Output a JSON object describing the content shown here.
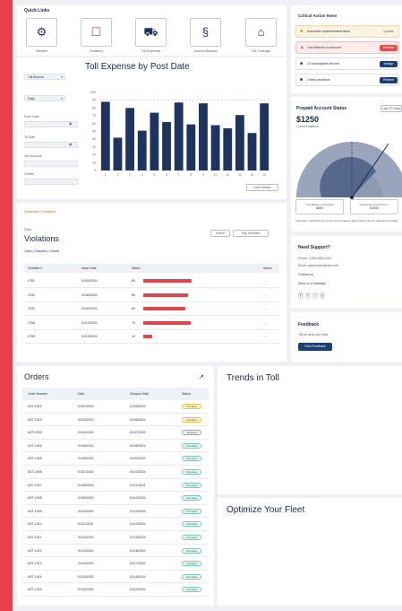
{
  "quick_links": {
    "title": "Quick Links",
    "items": [
      {
        "label": "Vehicles",
        "icon": "vehicle-icon"
      },
      {
        "label": "Violations",
        "icon": "violation-icon"
      },
      {
        "label": "Toll Expenses",
        "icon": "toll-icon"
      },
      {
        "label": "Account Balance",
        "icon": "balance-icon"
      },
      {
        "label": "Toll Coverage",
        "icon": "coverage-icon"
      }
    ]
  },
  "critical_actions": {
    "title": "Critical Action Items",
    "items": [
      {
        "text": "Automatic replenishment failed",
        "action": "Update",
        "style": "warn"
      },
      {
        "text": "Low balance on account",
        "action": "Review",
        "style": "danger"
      },
      {
        "text": "13 Unassigned devices",
        "action": "Assign",
        "style": "navy"
      },
      {
        "text": "2 New violations",
        "action": "Review",
        "style": "navy"
      }
    ]
  },
  "toll_chart": {
    "title": "Toll Expense by Post Date",
    "filter_select": "Toll Amount",
    "group_select": "Daily",
    "from_label": "From Date",
    "to_label": "To Date",
    "sub_label": "Sub Account",
    "vehicle_label": "Vehicle",
    "view_more": "View Details"
  },
  "chart_data": {
    "type": "bar",
    "title": "Toll Expense by Post Date",
    "categories": [
      "1",
      "2",
      "3",
      "4",
      "5",
      "6",
      "7",
      "8",
      "9",
      "10",
      "11",
      "12",
      "13",
      "14"
    ],
    "values": [
      88,
      42,
      80,
      51,
      74,
      62,
      87,
      59,
      86,
      58,
      54,
      71,
      48,
      86
    ],
    "ylim": [
      0,
      100
    ],
    "yticks": [
      "0",
      "10",
      "20",
      "30",
      "40",
      "50",
      "60",
      "70",
      "80",
      "90",
      "100"
    ],
    "color": "#1d3461"
  },
  "prepaid": {
    "title": "Prepaid Account Status",
    "filter": "Last 30 Days",
    "balance": "$1250",
    "balance_label": "Current balance",
    "low_threshold": {
      "label": "Low Balance Threshold",
      "value": "$500"
    },
    "replenish": {
      "label": "Replenishment Amount",
      "value": "$1000"
    },
    "note": "Automatic replenishment occurs when balance drops below the low balance threshold."
  },
  "support": {
    "title": "Need Support?",
    "phone": "Phone: 1-800-555-0100",
    "email": "Email: support@tollpass.com",
    "link1": "Contact us",
    "link2": "Send us a message"
  },
  "feedback": {
    "title": "Feedback",
    "text": "Tell us what you think",
    "button": "Give Feedback"
  },
  "violations": {
    "breadcrumb": "Dashboard / Violations",
    "kicker": "Fleet",
    "title": "Violations",
    "tabs": "Open  |  Disputed  |  Closed",
    "btn1": "Export",
    "btn2": "Pay Selected",
    "columns": [
      "Violation #",
      "Issue Date",
      "Status",
      "Action"
    ],
    "rows": [
      {
        "id": "4781",
        "date": "01/04/2024",
        "status": "80",
        "pct": 0.68,
        "act": "..."
      },
      {
        "id": "4782",
        "date": "01/06/2024",
        "status": "65",
        "pct": 0.62,
        "act": "..."
      },
      {
        "id": "4783",
        "date": "01/09/2024",
        "status": "60",
        "pct": 0.59,
        "act": "..."
      },
      {
        "id": "4784",
        "date": "01/12/2024",
        "status": "70",
        "pct": 0.66,
        "act": "..."
      },
      {
        "id": "4785",
        "date": "01/15/2024",
        "status": "10",
        "pct": 0.12,
        "act": "..."
      }
    ]
  },
  "orders": {
    "title": "Orders",
    "columns": [
      "Order Number",
      "Date",
      "Shipped Date",
      "Status"
    ],
    "rows": [
      {
        "num": "#OT-1001",
        "date": "01/02/2024",
        "ship": "01/05/2024",
        "status": "Pending",
        "style": "yellow"
      },
      {
        "num": "#OT-1002",
        "date": "01/03/2024",
        "ship": "01/06/2024",
        "status": "Pending",
        "style": "yellow"
      },
      {
        "num": "#OT-1003",
        "date": "01/04/2024",
        "ship": "01/07/2024",
        "status": "Shipped",
        "style": "grey"
      },
      {
        "num": "#OT-1004",
        "date": "01/05/2024",
        "ship": "01/08/2024",
        "status": "Complete",
        "style": "teal"
      },
      {
        "num": "#OT-1005",
        "date": "01/06/2024",
        "ship": "01/09/2024",
        "status": "Complete",
        "style": "teal"
      },
      {
        "num": "#OT-1006",
        "date": "01/07/2024",
        "ship": "01/10/2024",
        "status": "Complete",
        "style": "teal"
      },
      {
        "num": "#OT-1007",
        "date": "01/08/2024",
        "ship": "01/11/2024",
        "status": "Complete",
        "style": "teal"
      },
      {
        "num": "#OT-1008",
        "date": "01/09/2024",
        "ship": "01/12/2024",
        "status": "Complete",
        "style": "teal"
      },
      {
        "num": "#OT-1009",
        "date": "01/10/2024",
        "ship": "01/13/2024",
        "status": "Complete",
        "style": "teal"
      },
      {
        "num": "#OT-1010",
        "date": "01/11/2024",
        "ship": "01/14/2024",
        "status": "Complete",
        "style": "teal"
      },
      {
        "num": "#OT-1011",
        "date": "01/12/2024",
        "ship": "01/15/2024",
        "status": "Complete",
        "style": "teal"
      },
      {
        "num": "#OT-1012",
        "date": "01/13/2024",
        "ship": "01/16/2024",
        "status": "Complete",
        "style": "teal"
      },
      {
        "num": "#OT-1013",
        "date": "01/14/2024",
        "ship": "01/17/2024",
        "status": "Complete",
        "style": "teal"
      },
      {
        "num": "#OT-1014",
        "date": "01/15/2024",
        "ship": "01/18/2024",
        "status": "Complete",
        "style": "teal"
      },
      {
        "num": "#OT-1015",
        "date": "01/16/2024",
        "ship": "01/19/2024",
        "status": "Complete",
        "style": "teal"
      }
    ]
  },
  "trends": {
    "title": "Trends in Toll"
  },
  "optimize": {
    "title": "Optimize Your Fleet"
  }
}
